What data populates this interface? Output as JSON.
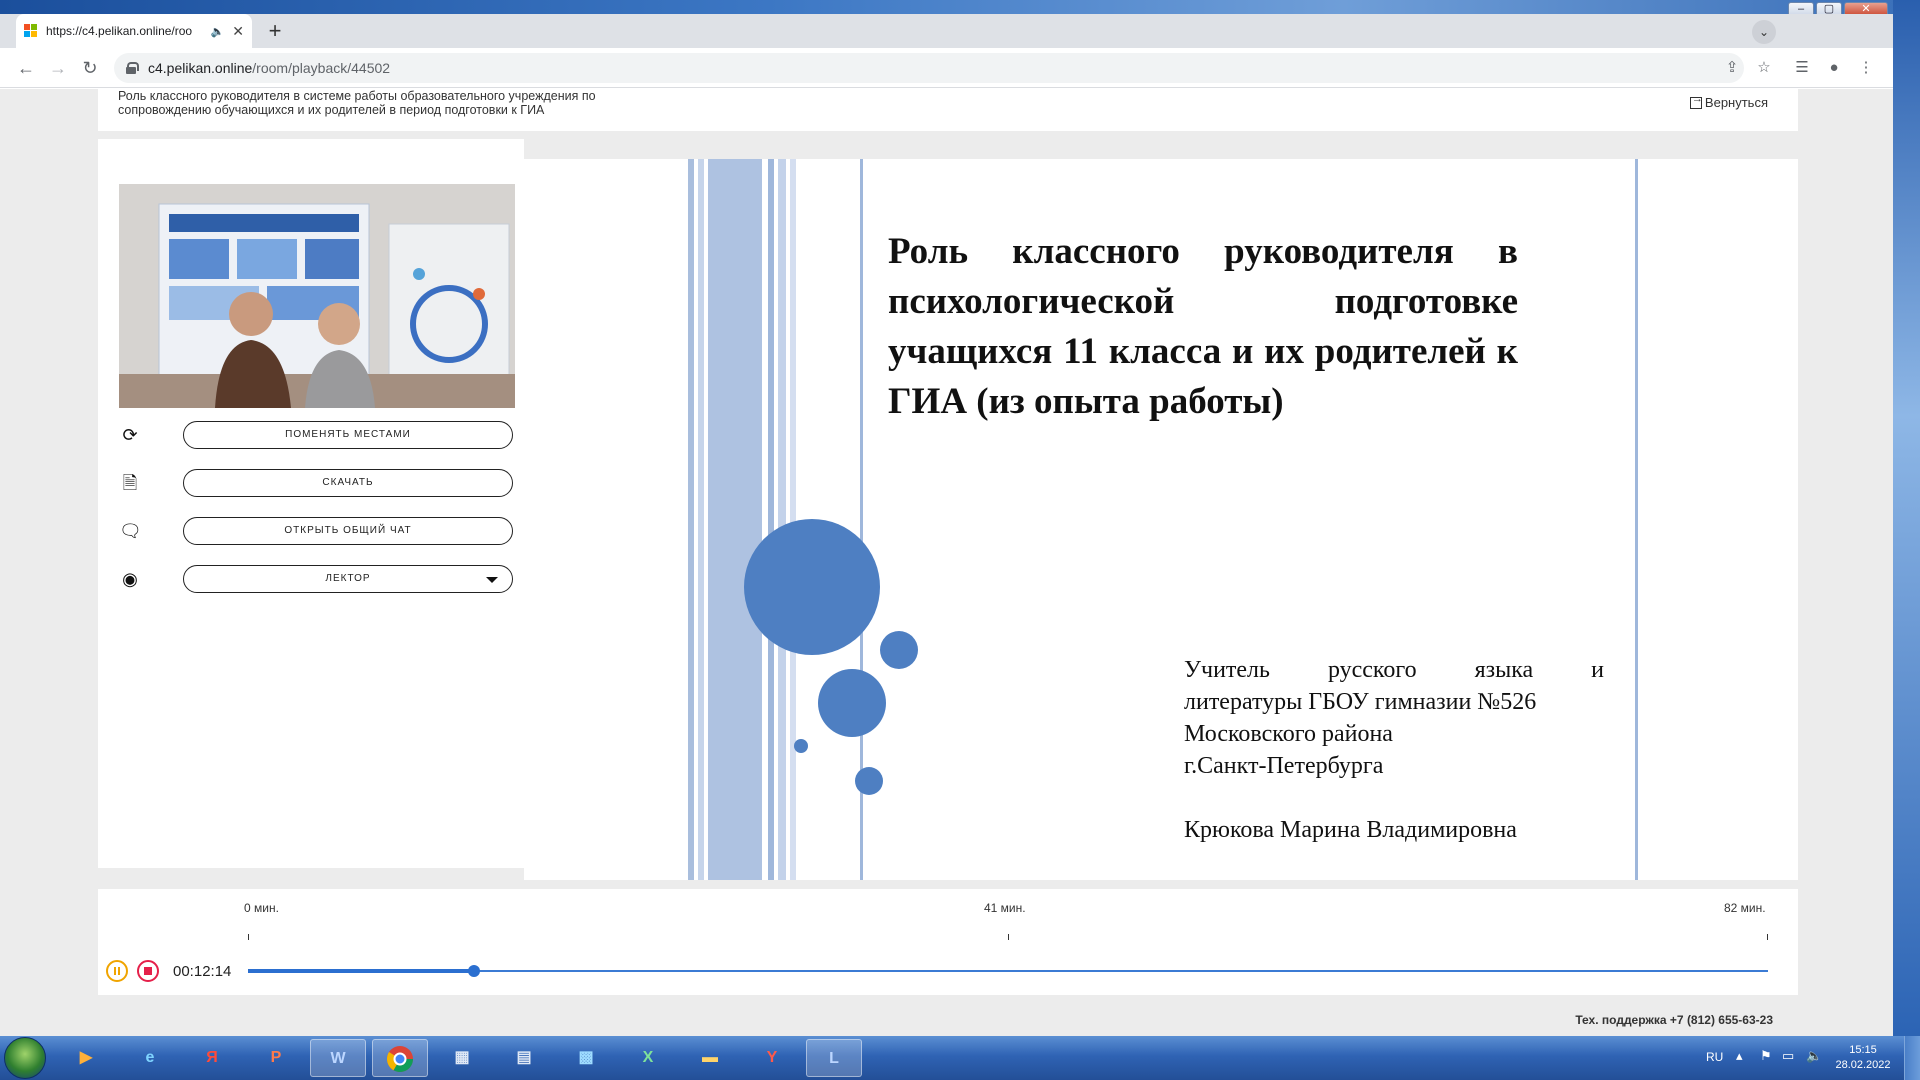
{
  "browser": {
    "tab_title": "https://c4.pelikan.online/roo",
    "tab_audio_icon": "speaker-icon",
    "url_host": "c4.pelikan.online",
    "url_path": "/room/playback/44502"
  },
  "header": {
    "course_title_line1": "Роль классного руководителя в системе работы образовательного учреждения по",
    "course_title_line2": "сопровождению обучающихся и их родителей в период подготовки к ГИА",
    "back_label": "Вернуться"
  },
  "actions": [
    {
      "icon": "swap-icon",
      "label": "поменять местами"
    },
    {
      "icon": "document-icon",
      "label": "скачать"
    },
    {
      "icon": "chat-icon",
      "label": "открыть общий чат"
    },
    {
      "icon": "webcam-icon",
      "label": "лектор"
    }
  ],
  "slide": {
    "title": "Роль классного руководителя в психологической подготовке учащихся 11 класса и их родителей к ГИА (из опыта работы)",
    "teacher_line1": "Учитель русского языка и",
    "teacher_line2": "литературы ГБОУ гимназии №526",
    "teacher_line3": "Московского района",
    "teacher_line4": "г.Санкт-Петербурга",
    "author_name": "Крюкова Марина Владимировна",
    "accent_color": "#4e7fc2"
  },
  "player": {
    "tick_start": "0 мин.",
    "tick_mid": "41 мин.",
    "tick_end": "82 мин.",
    "current_time": "00:12:14",
    "progress_fraction": 0.149,
    "pause_color": "#f0a400",
    "stop_color": "#e5204a"
  },
  "support": "Тех. поддержка +7 (812) 655-63-23",
  "taskbar": {
    "language": "RU",
    "time": "15:15",
    "date": "28.02.2022"
  }
}
